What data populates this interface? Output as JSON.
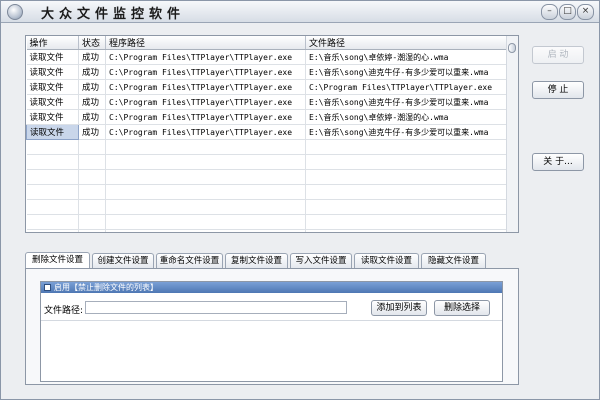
{
  "window": {
    "title": "大众文件监控软件",
    "controls": {
      "minimize": "–",
      "maximize": "□",
      "close": "×"
    }
  },
  "table": {
    "columns": [
      "操作",
      "状态",
      "程序路径",
      "文件路径"
    ],
    "rows": [
      [
        "读取文件",
        "成功",
        "C:\\Program Files\\TTPlayer\\TTPlayer.exe",
        "E:\\音乐\\song\\卓依婷-潮湿的心.wma"
      ],
      [
        "读取文件",
        "成功",
        "C:\\Program Files\\TTPlayer\\TTPlayer.exe",
        "E:\\音乐\\song\\迪克牛仔-有多少爱可以重来.wma"
      ],
      [
        "读取文件",
        "成功",
        "C:\\Program Files\\TTPlayer\\TTPlayer.exe",
        "C:\\Program Files\\TTPlayer\\TTPlayer.exe"
      ],
      [
        "读取文件",
        "成功",
        "C:\\Program Files\\TTPlayer\\TTPlayer.exe",
        "E:\\音乐\\song\\迪克牛仔-有多少爱可以重来.wma"
      ],
      [
        "读取文件",
        "成功",
        "C:\\Program Files\\TTPlayer\\TTPlayer.exe",
        "E:\\音乐\\song\\卓依婷-潮湿的心.wma"
      ],
      [
        "读取文件",
        "成功",
        "C:\\Program Files\\TTPlayer\\TTPlayer.exe",
        "E:\\音乐\\song\\迪克牛仔-有多少爱可以重来.wma"
      ]
    ],
    "selected_row": 5
  },
  "side_buttons": {
    "start": "启 动",
    "stop": "停 止",
    "about": "关 于..."
  },
  "tabs": [
    "删除文件设置",
    "创建文件设置",
    "重命名文件设置",
    "复制文件设置",
    "写入文件设置",
    "读取文件设置",
    "隐藏文件设置"
  ],
  "active_tab": 0,
  "delete_panel": {
    "group_title": "启用【禁止删除文件的列表】",
    "path_label": "文件路径:",
    "path_value": "",
    "add_button": "添加到列表",
    "remove_button": "删除选择"
  }
}
